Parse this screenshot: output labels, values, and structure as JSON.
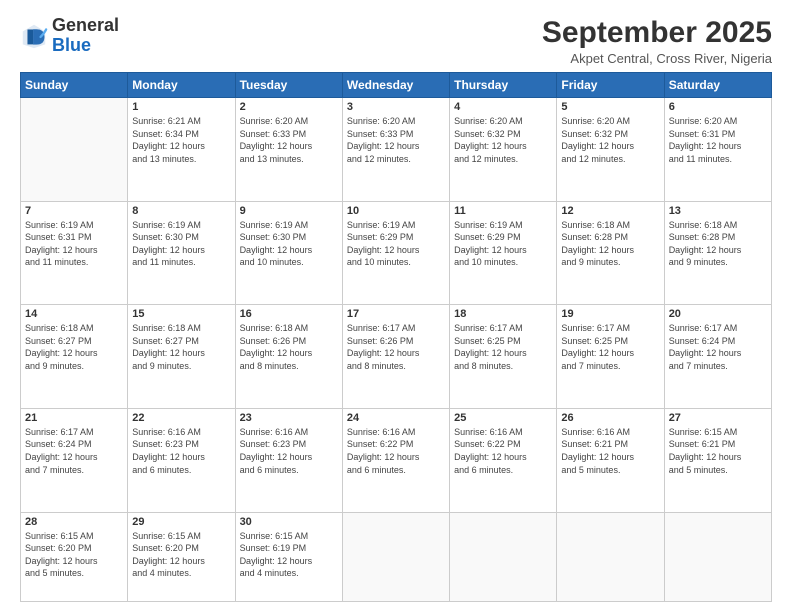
{
  "logo": {
    "general": "General",
    "blue": "Blue"
  },
  "header": {
    "title": "September 2025",
    "subtitle": "Akpet Central, Cross River, Nigeria"
  },
  "days": [
    "Sunday",
    "Monday",
    "Tuesday",
    "Wednesday",
    "Thursday",
    "Friday",
    "Saturday"
  ],
  "weeks": [
    [
      {
        "num": "",
        "info": ""
      },
      {
        "num": "1",
        "info": "Sunrise: 6:21 AM\nSunset: 6:34 PM\nDaylight: 12 hours\nand 13 minutes."
      },
      {
        "num": "2",
        "info": "Sunrise: 6:20 AM\nSunset: 6:33 PM\nDaylight: 12 hours\nand 13 minutes."
      },
      {
        "num": "3",
        "info": "Sunrise: 6:20 AM\nSunset: 6:33 PM\nDaylight: 12 hours\nand 12 minutes."
      },
      {
        "num": "4",
        "info": "Sunrise: 6:20 AM\nSunset: 6:32 PM\nDaylight: 12 hours\nand 12 minutes."
      },
      {
        "num": "5",
        "info": "Sunrise: 6:20 AM\nSunset: 6:32 PM\nDaylight: 12 hours\nand 12 minutes."
      },
      {
        "num": "6",
        "info": "Sunrise: 6:20 AM\nSunset: 6:31 PM\nDaylight: 12 hours\nand 11 minutes."
      }
    ],
    [
      {
        "num": "7",
        "info": "Sunrise: 6:19 AM\nSunset: 6:31 PM\nDaylight: 12 hours\nand 11 minutes."
      },
      {
        "num": "8",
        "info": "Sunrise: 6:19 AM\nSunset: 6:30 PM\nDaylight: 12 hours\nand 11 minutes."
      },
      {
        "num": "9",
        "info": "Sunrise: 6:19 AM\nSunset: 6:30 PM\nDaylight: 12 hours\nand 10 minutes."
      },
      {
        "num": "10",
        "info": "Sunrise: 6:19 AM\nSunset: 6:29 PM\nDaylight: 12 hours\nand 10 minutes."
      },
      {
        "num": "11",
        "info": "Sunrise: 6:19 AM\nSunset: 6:29 PM\nDaylight: 12 hours\nand 10 minutes."
      },
      {
        "num": "12",
        "info": "Sunrise: 6:18 AM\nSunset: 6:28 PM\nDaylight: 12 hours\nand 9 minutes."
      },
      {
        "num": "13",
        "info": "Sunrise: 6:18 AM\nSunset: 6:28 PM\nDaylight: 12 hours\nand 9 minutes."
      }
    ],
    [
      {
        "num": "14",
        "info": "Sunrise: 6:18 AM\nSunset: 6:27 PM\nDaylight: 12 hours\nand 9 minutes."
      },
      {
        "num": "15",
        "info": "Sunrise: 6:18 AM\nSunset: 6:27 PM\nDaylight: 12 hours\nand 9 minutes."
      },
      {
        "num": "16",
        "info": "Sunrise: 6:18 AM\nSunset: 6:26 PM\nDaylight: 12 hours\nand 8 minutes."
      },
      {
        "num": "17",
        "info": "Sunrise: 6:17 AM\nSunset: 6:26 PM\nDaylight: 12 hours\nand 8 minutes."
      },
      {
        "num": "18",
        "info": "Sunrise: 6:17 AM\nSunset: 6:25 PM\nDaylight: 12 hours\nand 8 minutes."
      },
      {
        "num": "19",
        "info": "Sunrise: 6:17 AM\nSunset: 6:25 PM\nDaylight: 12 hours\nand 7 minutes."
      },
      {
        "num": "20",
        "info": "Sunrise: 6:17 AM\nSunset: 6:24 PM\nDaylight: 12 hours\nand 7 minutes."
      }
    ],
    [
      {
        "num": "21",
        "info": "Sunrise: 6:17 AM\nSunset: 6:24 PM\nDaylight: 12 hours\nand 7 minutes."
      },
      {
        "num": "22",
        "info": "Sunrise: 6:16 AM\nSunset: 6:23 PM\nDaylight: 12 hours\nand 6 minutes."
      },
      {
        "num": "23",
        "info": "Sunrise: 6:16 AM\nSunset: 6:23 PM\nDaylight: 12 hours\nand 6 minutes."
      },
      {
        "num": "24",
        "info": "Sunrise: 6:16 AM\nSunset: 6:22 PM\nDaylight: 12 hours\nand 6 minutes."
      },
      {
        "num": "25",
        "info": "Sunrise: 6:16 AM\nSunset: 6:22 PM\nDaylight: 12 hours\nand 6 minutes."
      },
      {
        "num": "26",
        "info": "Sunrise: 6:16 AM\nSunset: 6:21 PM\nDaylight: 12 hours\nand 5 minutes."
      },
      {
        "num": "27",
        "info": "Sunrise: 6:15 AM\nSunset: 6:21 PM\nDaylight: 12 hours\nand 5 minutes."
      }
    ],
    [
      {
        "num": "28",
        "info": "Sunrise: 6:15 AM\nSunset: 6:20 PM\nDaylight: 12 hours\nand 5 minutes."
      },
      {
        "num": "29",
        "info": "Sunrise: 6:15 AM\nSunset: 6:20 PM\nDaylight: 12 hours\nand 4 minutes."
      },
      {
        "num": "30",
        "info": "Sunrise: 6:15 AM\nSunset: 6:19 PM\nDaylight: 12 hours\nand 4 minutes."
      },
      {
        "num": "",
        "info": ""
      },
      {
        "num": "",
        "info": ""
      },
      {
        "num": "",
        "info": ""
      },
      {
        "num": "",
        "info": ""
      }
    ]
  ]
}
